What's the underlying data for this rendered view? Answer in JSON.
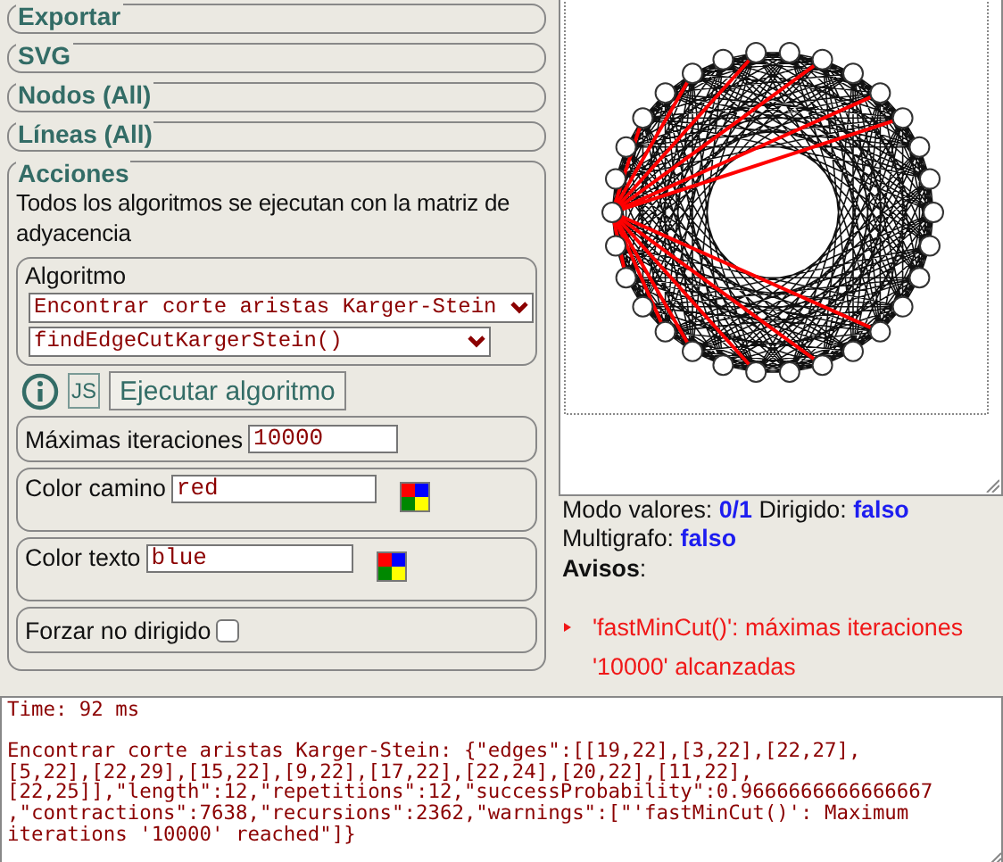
{
  "sections": [
    {
      "title": "Exportar",
      "expanded": false
    },
    {
      "title": "SVG",
      "expanded": false
    },
    {
      "title": "Nodos (All)",
      "expanded": false
    },
    {
      "title": "Líneas (All)",
      "expanded": false
    },
    {
      "title": "Acciones",
      "expanded": true
    }
  ],
  "actions": {
    "description": "Todos los algoritmos se ejecutan con la matriz de adyacencia",
    "algorithm": {
      "label": "Algoritmo",
      "category": "Encontrar corte aristas Karger-Stein",
      "function": "findEdgeCutKargerStein()"
    },
    "js_button": "JS",
    "run_button": "Ejecutar algoritmo",
    "params": [
      {
        "kind": "text",
        "label": "Máximas iteraciones",
        "value": "10000"
      },
      {
        "kind": "color",
        "label": "Color camino",
        "value": "red"
      },
      {
        "kind": "color",
        "label": "Color texto",
        "value": "blue"
      },
      {
        "kind": "checkbox",
        "label": "Forzar no dirigido",
        "checked": false
      }
    ]
  },
  "status": [
    [
      {
        "label": "Modo valores:",
        "value": "0/1"
      },
      {
        "label": "Dirigido:",
        "value": "falso"
      }
    ],
    [
      {
        "label": "Multigrafo:",
        "value": "falso"
      }
    ]
  ],
  "warnings_title": "**Avisos**:",
  "warnings": [
    "'fastMinCut()': máximas iteraciones '10000' alcanzadas"
  ],
  "output": {
    "time": "Time: 92 ms",
    "result_lines": [
      "Encontrar corte aristas Karger-Stein: {\"edges\":[[19,22],[3,22],[22,27],",
      "[5,22],[22,29],[15,22],[9,22],[17,22],[22,24],[20,22],[11,22],",
      "[22,25]],\"length\":12,\"repetitions\":12,\"successProbability\":0.9666666666666667",
      ",\"contractions\":7638,\"recursions\":2362,\"warnings\":[\"'fastMinCut()': Maximum",
      "iterations '10000' reached\"]}"
    ]
  }
}
